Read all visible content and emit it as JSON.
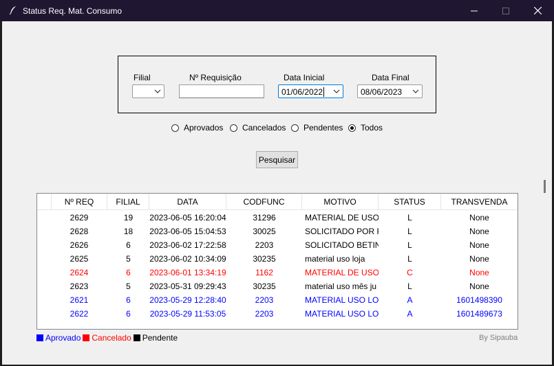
{
  "window": {
    "title": "Status Req. Mat. Consumo",
    "minimize_glyph": "—",
    "maximize_glyph": "☐",
    "close_glyph": "✕"
  },
  "filters": {
    "filial_label": "Filial",
    "filial_value": "",
    "requisicao_label": "Nº Requisição",
    "requisicao_value": "",
    "data_inicial_label": "Data Inicial",
    "data_inicial_value": "01/06/2022",
    "data_final_label": "Data Final",
    "data_final_value": "08/06/2023"
  },
  "radios": [
    {
      "label": "Aprovados",
      "selected": false
    },
    {
      "label": "Cancelados",
      "selected": false
    },
    {
      "label": "Pendentes",
      "selected": false
    },
    {
      "label": "Todos",
      "selected": true
    }
  ],
  "search_button": "Pesquisar",
  "table": {
    "columns": [
      "Nº REQ",
      "FILIAL",
      "DATA",
      "CODFUNC",
      "MOTIVO",
      "STATUS",
      "TRANSVENDA"
    ],
    "rows": [
      {
        "cells": [
          "2629",
          "19",
          "2023-06-05 16:20:04",
          "31296",
          "MATERIAL DE USO-",
          "L",
          "None"
        ],
        "status": "pendente"
      },
      {
        "cells": [
          "2628",
          "18",
          "2023-06-05 15:04:53",
          "30025",
          "SOLICITADO POR R",
          "L",
          "None"
        ],
        "status": "pendente"
      },
      {
        "cells": [
          "2626",
          "6",
          "2023-06-02 17:22:58",
          "2203",
          "SOLICITADO BETINI",
          "L",
          "None"
        ],
        "status": "pendente"
      },
      {
        "cells": [
          "2625",
          "5",
          "2023-06-02 10:34:09",
          "30235",
          "material uso loja",
          "L",
          "None"
        ],
        "status": "pendente"
      },
      {
        "cells": [
          "2624",
          "6",
          "2023-06-01 13:34:19",
          "1162",
          "MATERIAL DE USO I",
          "C",
          "None"
        ],
        "status": "cancelado"
      },
      {
        "cells": [
          "2623",
          "5",
          "2023-05-31 09:29:43",
          "30235",
          "material uso mês ju",
          "L",
          "None"
        ],
        "status": "pendente"
      },
      {
        "cells": [
          "2621",
          "6",
          "2023-05-29 12:28:40",
          "2203",
          "MATERIAL USO LOC",
          "A",
          "1601498390"
        ],
        "status": "aprovado"
      },
      {
        "cells": [
          "2622",
          "6",
          "2023-05-29 11:53:05",
          "2203",
          "MATERIAL USO LOC",
          "A",
          "1601489673"
        ],
        "status": "aprovado"
      }
    ]
  },
  "legend": [
    {
      "label": "Aprovado",
      "color": "#0000ff"
    },
    {
      "label": "Cancelado",
      "color": "#ff0000"
    },
    {
      "label": "Pendente",
      "color": "#000000"
    }
  ],
  "credit": "By Sipauba",
  "colors": {
    "aprovado": "#0000ff",
    "cancelado": "#ff0000",
    "pendente": "#000000",
    "titlebar": "#1f1631"
  }
}
